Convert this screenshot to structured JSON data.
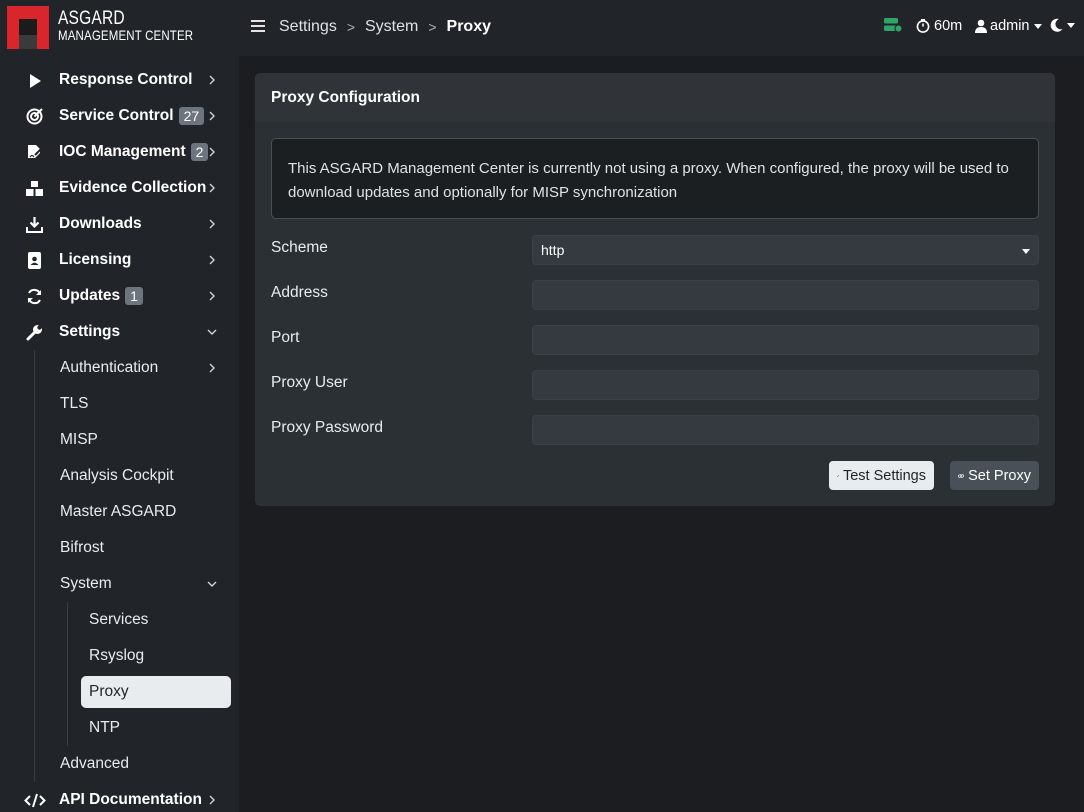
{
  "logo": {
    "line1": "ASGARD",
    "line2": "MANAGEMENT CENTER"
  },
  "nav": {
    "items": [
      {
        "label": "Response Control",
        "icon": "play-icon"
      },
      {
        "label": "Service Control",
        "badge": "27",
        "icon": "crosshair-icon"
      },
      {
        "label": "IOC Management",
        "badge": "2",
        "icon": "file-signature-icon"
      },
      {
        "label": "Evidence Collection",
        "icon": "boxes-icon"
      },
      {
        "label": "Downloads",
        "icon": "download-icon"
      },
      {
        "label": "Licensing",
        "icon": "id-badge-icon"
      },
      {
        "label": "Updates",
        "badge": "1",
        "icon": "sync-icon"
      },
      {
        "label": "Settings",
        "icon": "wrench-icon"
      }
    ],
    "settings_sub": [
      "Authentication",
      "TLS",
      "MISP",
      "Analysis Cockpit",
      "Master ASGARD",
      "Bifrost",
      "System"
    ],
    "system_sub": [
      "Services",
      "Rsyslog",
      "Proxy",
      "NTP"
    ],
    "advanced": "Advanced",
    "api_docs": "API Documentation"
  },
  "topbar": {
    "breadcrumb": [
      "Settings",
      "System",
      "Proxy"
    ],
    "session_timer": "60m",
    "user": "admin"
  },
  "card": {
    "title": "Proxy Configuration",
    "info": "This ASGARD Management Center is currently not using a proxy. When configured, the proxy will be used to download updates and optionally for MISP synchronization",
    "fields": {
      "scheme_label": "Scheme",
      "scheme_value": "http",
      "address_label": "Address",
      "address_value": "",
      "port_label": "Port",
      "port_value": "",
      "user_label": "Proxy User",
      "user_value": "",
      "password_label": "Proxy Password",
      "password_value": ""
    },
    "buttons": {
      "test": "Test Settings",
      "set": "Set Proxy"
    }
  },
  "colors": {
    "accent_red": "#d9262c",
    "active_pill": "#e9ecef",
    "status_green": "#2fa56a"
  }
}
